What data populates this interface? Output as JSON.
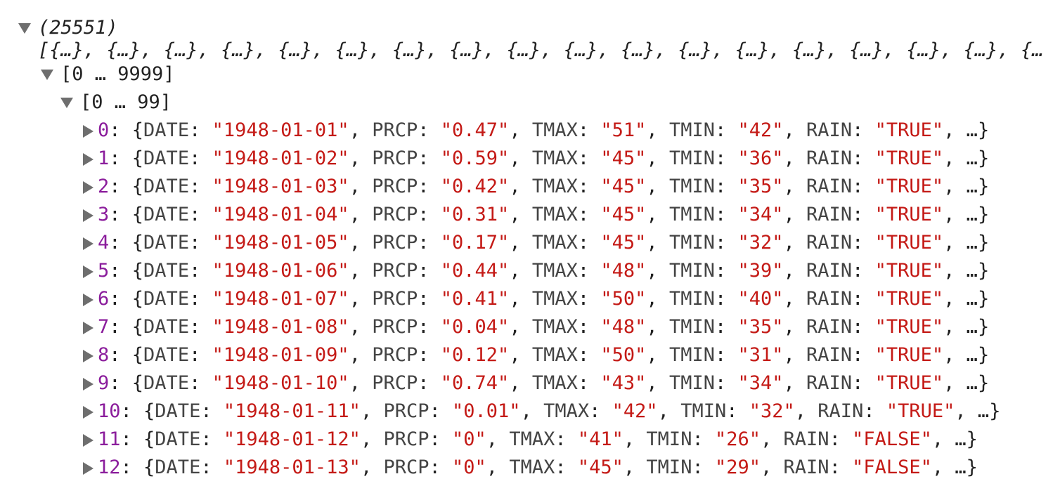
{
  "console": {
    "array_length": "(25551)",
    "array_preview": "[{…}, {…}, {…}, {…}, {…}, {…}, {…}, {…}, {…}, {…}, {…}, {…}, {…}, {…}, {…}, {…}, {…}, {…",
    "group_outer": "[0 … 9999]",
    "group_inner": "[0 … 99]",
    "ellipsis": "…",
    "keys": [
      "DATE",
      "PRCP",
      "TMAX",
      "TMIN",
      "RAIN"
    ],
    "rows": [
      {
        "index": "0",
        "DATE": "1948-01-01",
        "PRCP": "0.47",
        "TMAX": "51",
        "TMIN": "42",
        "RAIN": "TRUE"
      },
      {
        "index": "1",
        "DATE": "1948-01-02",
        "PRCP": "0.59",
        "TMAX": "45",
        "TMIN": "36",
        "RAIN": "TRUE"
      },
      {
        "index": "2",
        "DATE": "1948-01-03",
        "PRCP": "0.42",
        "TMAX": "45",
        "TMIN": "35",
        "RAIN": "TRUE"
      },
      {
        "index": "3",
        "DATE": "1948-01-04",
        "PRCP": "0.31",
        "TMAX": "45",
        "TMIN": "34",
        "RAIN": "TRUE"
      },
      {
        "index": "4",
        "DATE": "1948-01-05",
        "PRCP": "0.17",
        "TMAX": "45",
        "TMIN": "32",
        "RAIN": "TRUE"
      },
      {
        "index": "5",
        "DATE": "1948-01-06",
        "PRCP": "0.44",
        "TMAX": "48",
        "TMIN": "39",
        "RAIN": "TRUE"
      },
      {
        "index": "6",
        "DATE": "1948-01-07",
        "PRCP": "0.41",
        "TMAX": "50",
        "TMIN": "40",
        "RAIN": "TRUE"
      },
      {
        "index": "7",
        "DATE": "1948-01-08",
        "PRCP": "0.04",
        "TMAX": "48",
        "TMIN": "35",
        "RAIN": "TRUE"
      },
      {
        "index": "8",
        "DATE": "1948-01-09",
        "PRCP": "0.12",
        "TMAX": "50",
        "TMIN": "31",
        "RAIN": "TRUE"
      },
      {
        "index": "9",
        "DATE": "1948-01-10",
        "PRCP": "0.74",
        "TMAX": "43",
        "TMIN": "34",
        "RAIN": "TRUE"
      },
      {
        "index": "10",
        "DATE": "1948-01-11",
        "PRCP": "0.01",
        "TMAX": "42",
        "TMIN": "32",
        "RAIN": "TRUE"
      },
      {
        "index": "11",
        "DATE": "1948-01-12",
        "PRCP": "0",
        "TMAX": "41",
        "TMIN": "26",
        "RAIN": "FALSE"
      },
      {
        "index": "12",
        "DATE": "1948-01-13",
        "PRCP": "0",
        "TMAX": "45",
        "TMIN": "29",
        "RAIN": "FALSE"
      }
    ],
    "colors": {
      "index": "#8b1d9c",
      "string": "#c41a16",
      "key": "#444444",
      "triangle": "#6e6e6e"
    }
  }
}
